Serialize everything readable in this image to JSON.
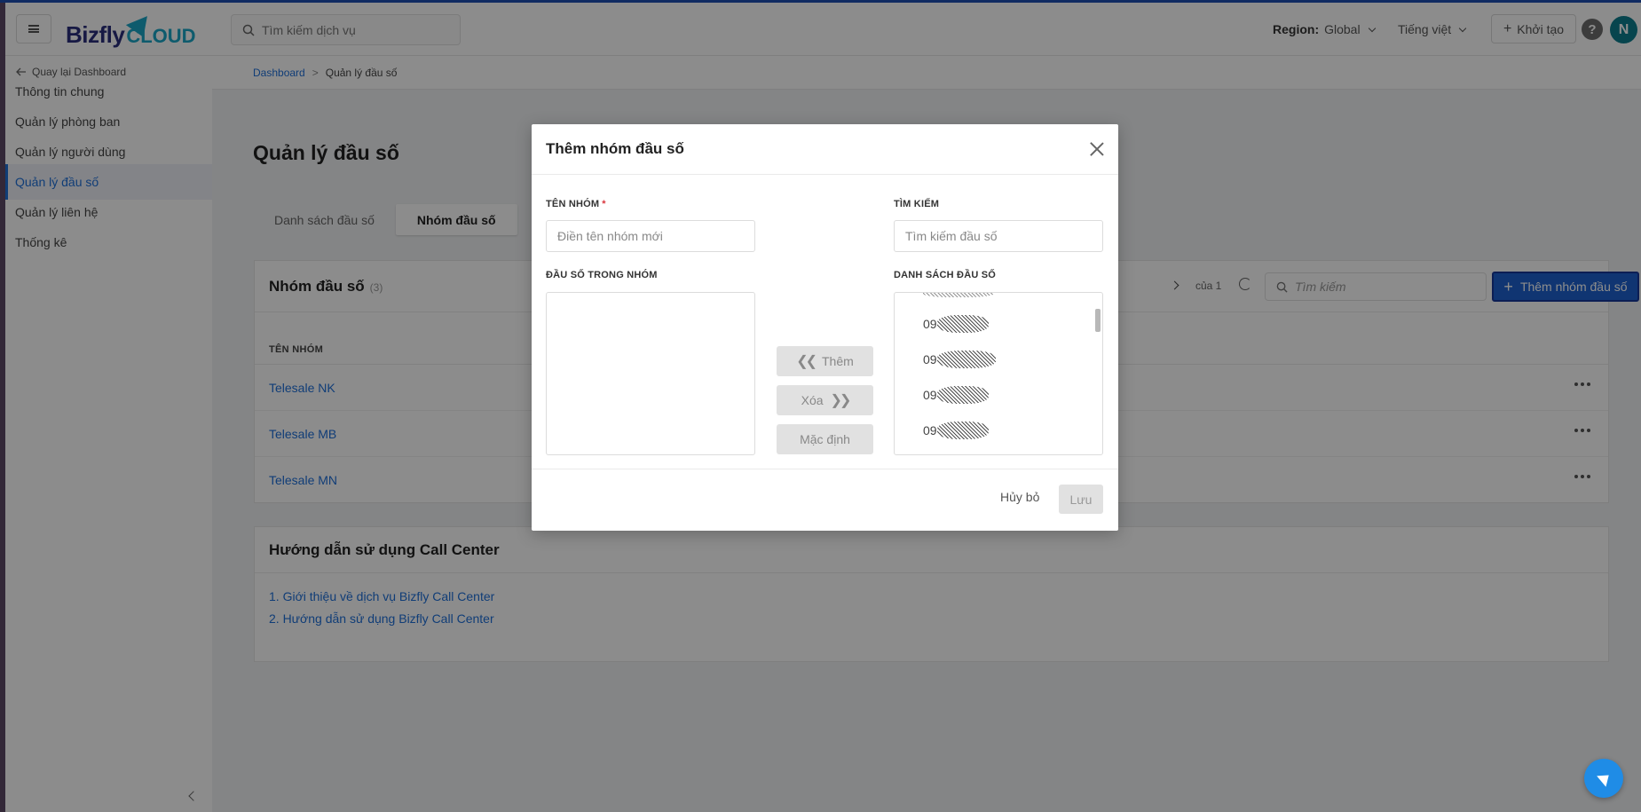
{
  "header": {
    "logo_main": "Bizfly",
    "logo_sub": "CLOUD",
    "search_placeholder": "Tìm kiếm dịch vụ",
    "region_label": "Region:",
    "region_value": "Global",
    "language": "Tiếng việt",
    "create_label": "Khởi tạo",
    "help_icon": "?",
    "avatar_initial": "N"
  },
  "sidebar": {
    "back_label": "Quay lại Dashboard",
    "items": [
      {
        "label": "Thông tin chung",
        "active": false
      },
      {
        "label": "Quản lý phòng ban",
        "active": false
      },
      {
        "label": "Quản lý người dùng",
        "active": false
      },
      {
        "label": "Quản lý đầu số",
        "active": true
      },
      {
        "label": "Quản lý liên hệ",
        "active": false
      },
      {
        "label": "Thống kê",
        "active": false
      }
    ]
  },
  "breadcrumb": {
    "root": "Dashboard",
    "separator": ">",
    "current": "Quản lý đầu số"
  },
  "main": {
    "title": "Quản lý đầu số",
    "tabs": [
      {
        "label": "Danh sách đầu số",
        "active": false
      },
      {
        "label": "Nhóm đầu số",
        "active": true
      }
    ],
    "panel": {
      "title": "Nhóm đầu số",
      "count": "(3)",
      "pager_text": "của 1",
      "search_placeholder": "Tìm kiếm",
      "add_button": "Thêm nhóm đầu số",
      "column_header": "TÊN NHÓM",
      "groups": [
        "Telesale NK",
        "Telesale MB",
        "Telesale MN"
      ]
    },
    "guide": {
      "title": "Hướng dẫn sử dụng Call Center",
      "links": [
        "1. Giới thiệu về dịch vụ Bizfly Call Center",
        "2. Hướng dẫn sử dụng Bizfly Call Center"
      ]
    }
  },
  "modal": {
    "title": "Thêm nhóm đầu số",
    "group_name_label": "TÊN NHÓM",
    "required_mark": "*",
    "group_name_placeholder": "Điền tên nhóm mới",
    "search_label": "TÌM KIẾM",
    "search_placeholder": "Tìm kiếm đầu số",
    "in_group_label": "ĐẦU SỐ TRONG NHÓM",
    "list_label": "DANH SÁCH ĐẦU SỐ",
    "numbers": [
      "09",
      "09",
      "09",
      "09"
    ],
    "add_button": "Thêm",
    "remove_button": "Xóa",
    "default_button": "Mặc định",
    "cancel_button": "Hủy bỏ",
    "save_button": "Lưu"
  },
  "colors": {
    "accent": "#1e62d0",
    "link": "#1e6fd9",
    "avatar": "#0d7f8f",
    "sidebar_strip": "#5d4a66"
  }
}
